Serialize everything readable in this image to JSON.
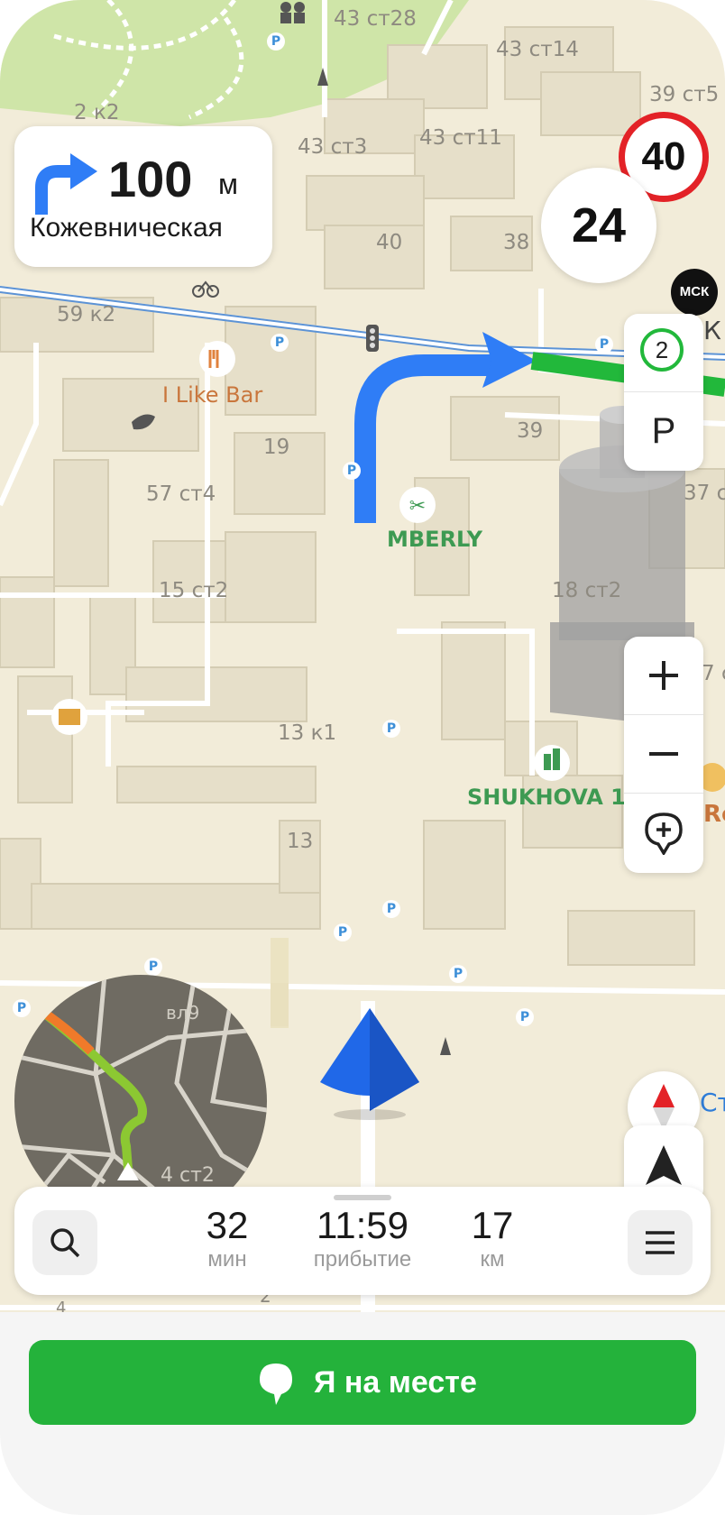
{
  "maneuver": {
    "distance": "100",
    "unit": "м",
    "street": "Кожевническая"
  },
  "speed": {
    "limit": "40",
    "current": "24"
  },
  "city_badge": "МСК",
  "side_panel": {
    "traffic_level": "2",
    "parking_label": "P"
  },
  "map_labels": {
    "addresses": [
      "43 ст28",
      "43 ст14",
      "39 ст5",
      "2 к2",
      "43 ст3",
      "43 ст11",
      "40",
      "38",
      "59 к2",
      "19",
      "39",
      "57 ст4",
      "37 с",
      "15 ст2",
      "18 ст2",
      "13 к1",
      "13",
      "вл9",
      "4 ст2",
      "2",
      "4"
    ],
    "poi": {
      "bar": "I Like Bar",
      "salon": "MBERLY",
      "complex": "SHUKHOVA 1",
      "cut_k": "К",
      "cut_st": "Ст",
      "cut_re": "Re",
      "cut_7": "7 с"
    },
    "parking_marker": "P"
  },
  "trip": {
    "time_value": "32",
    "time_unit": "мин",
    "arrival_value": "11:59",
    "arrival_unit": "прибытие",
    "distance_value": "17",
    "distance_unit": "км"
  },
  "arrive_button": "Я на месте",
  "colors": {
    "route_blue": "#2f7df6",
    "traffic_green": "#22b83b",
    "traffic_yellow": "#f0c020",
    "traffic_red": "#e83a2f",
    "button_green": "#24b23b",
    "speed_red": "#e32227"
  },
  "icons": [
    "turn-right-icon",
    "search-icon",
    "menu-icon",
    "zoom-in-icon",
    "zoom-out-icon",
    "add-point-icon",
    "compass-icon",
    "navigation-arrow-icon",
    "location-pin-icon",
    "my-position-arrow-icon"
  ]
}
